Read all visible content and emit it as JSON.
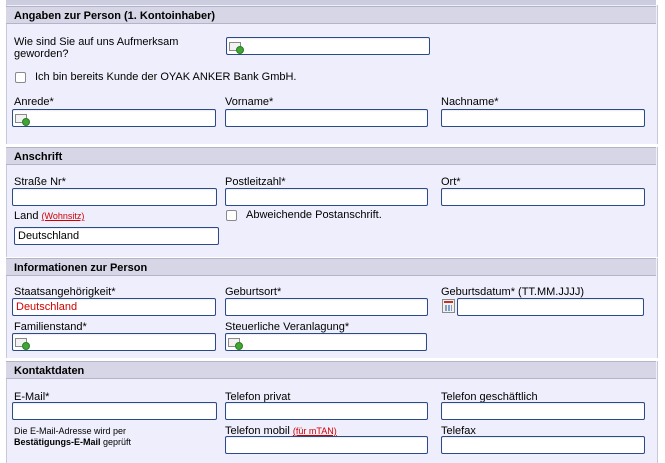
{
  "sections": {
    "person": "Angaben zur Person (1. Kontoinhaber)",
    "address": "Anschrift",
    "info": "Informationen zur Person",
    "contact": "Kontaktdaten"
  },
  "person": {
    "aufmerksam_label": "Wie sind Sie auf uns Aufmerksam geworden?",
    "bestandskunde_label": "Ich bin bereits Kunde der OYAK ANKER Bank GmbH.",
    "anrede_label": "Anrede*",
    "vorname_label": "Vorname*",
    "nachname_label": "Nachname*"
  },
  "address": {
    "strasse_label": "Straße Nr*",
    "plz_label": "Postleitzahl*",
    "ort_label": "Ort*",
    "land_label": "Land",
    "wohnsitz_link": "(Wohnsitz)",
    "abweichend_label": "Abweichende Postanschrift.",
    "land_value": "Deutschland"
  },
  "info": {
    "staat_label": "Staatsangehörigkeit*",
    "staat_value": "Deutschland",
    "geburtsort_label": "Geburtsort*",
    "geburtsdatum_label": "Geburtsdatum* (TT.MM.JJJJ)",
    "familienstand_label": "Familienstand*",
    "steuer_label": "Steuerliche Veranlagung*"
  },
  "contact": {
    "email_label": "E-Mail*",
    "tel_privat_label": "Telefon privat",
    "tel_geschaeft_label": "Telefon geschäftlich",
    "note_line1": "Die E-Mail-Adresse wird per",
    "note_bold": "Bestätigungs-E-Mail",
    "note_rest": " geprüft",
    "tel_mobil_label": "Telefon mobil",
    "mtan_link": "(für mTAN)",
    "telefax_label": "Telefax"
  },
  "colors": {
    "section_bg": "#eeeefc",
    "header_bg": "#d6d6e6",
    "error_text": "#d00000"
  }
}
